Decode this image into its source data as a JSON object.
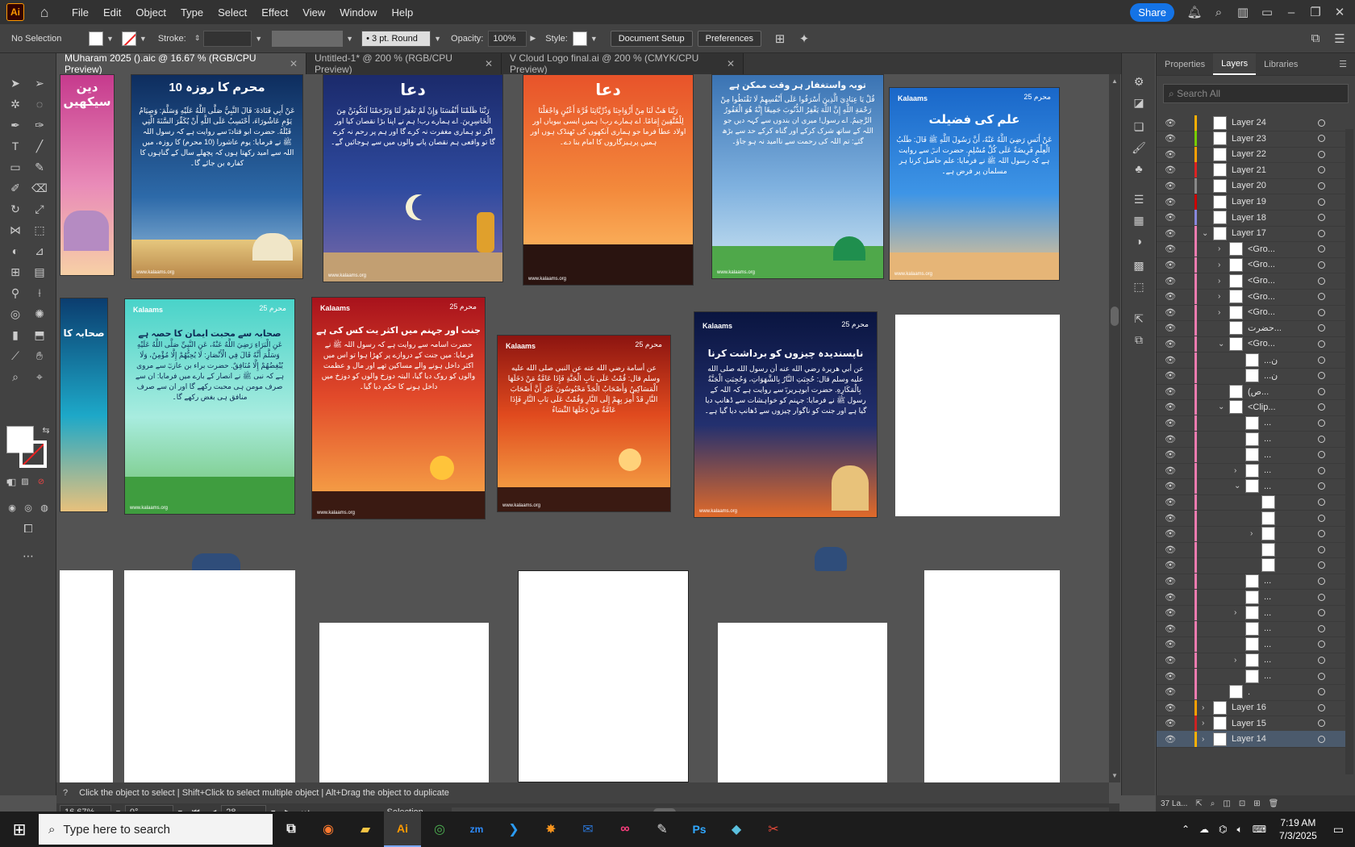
{
  "menubar": {
    "app_logo": "Ai",
    "menus": [
      "File",
      "Edit",
      "Object",
      "Type",
      "Select",
      "Effect",
      "View",
      "Window",
      "Help"
    ],
    "share_label": "Share"
  },
  "control_bar": {
    "selection": "No Selection",
    "stroke_label": "Stroke:",
    "brush": "3 pt. Round",
    "opacity_label": "Opacity:",
    "opacity_value": "100%",
    "style_label": "Style:",
    "document_setup": "Document Setup",
    "preferences": "Preferences"
  },
  "tabs": [
    {
      "label": "MUharam 2025 ().aic @ 16.67 % (RGB/CPU Preview)"
    },
    {
      "label": "Untitled-1* @ 200 % (RGB/CPU Preview)"
    },
    {
      "label": "V Cloud Logo final.ai @ 200 % (CMYK/CPU Preview)"
    }
  ],
  "artboards": {
    "a1_title": "دین سیکھیں",
    "a2_title": "10 محرم کا روزہ",
    "a2_body": "عَنْ أَبِي قَتَادَةَ: قَالَ النَّبِيُّ صَلَّى اللَّهُ عَلَيْهِ وَسَلَّمَ: وَصِيَامُ يَوْمِ عَاشُورَاءَ، أَحْتَسِبُ عَلَى اللَّهِ أَنْ يُكَفِّرَ السَّنَةَ الَّتِي قَبْلَهُ. حضرت ابو قتادہؓ سے روایت ہے کہ رسول اللہ ﷺ نے فرمایا: یوم عاشورا (10 محرم) کا روزہ، میں اللہ سے امید رکھتا ہوں کہ پچھلے سال کے گناہوں کا کفارہ بن جائے گا۔",
    "a3_title": "دعا",
    "a3_body": "رَبَّنَا ظَلَمْنَا أَنْفُسَنَا وَإِنْ لَمْ تَغْفِرْ لَنَا وَتَرْحَمْنَا لَنَكُونَنَّ مِنَ الْخَاسِرِينَ. اے ہمارے رب! ہم نے اپنا بڑا نقصان کیا اور اگر تو ہماری مغفرت نہ کرے گا اور ہم پر رحم نہ کرے گا تو واقعی ہم نقصان پانے والوں میں سے ہوجائیں گے۔",
    "a4_title": "دعا",
    "a4_body": "رَبَّنَا هَبْ لَنَا مِنْ أَزْوَاجِنَا وَذُرِّيَّاتِنَا قُرَّةَ أَعْيُنٍ وَاجْعَلْنَا لِلْمُتَّقِينَ إِمَامًا. اے ہمارے رب! ہمیں ایسی بیویاں اور اولاد عطا فرما جو ہماری آنکھوں کی ٹھنڈک ہوں اور ہمیں پرہیزگاروں کا امام بنا دے۔",
    "a5_title": "توبہ واستغفار ہر وقت ممکن ہے",
    "a5_body": "قُلْ يَا عِبَادِيَ الَّذِينَ أَسْرَفُوا عَلَى أَنْفُسِهِمْ لَا تَقْنَطُوا مِنْ رَحْمَةِ اللَّهِ إِنَّ اللَّهَ يَغْفِرُ الذُّنُوبَ جَمِيعًا إِنَّهُ هُوَ الْغَفُورُ الرَّحِيمُ. اے رسول! میری ان بندوں سے کہہ دیں جو اللہ کے ساتھ شرک کرکے اور گناہ کرکے حد سے بڑھ گئے: تم اللہ کی رحمت سے ناامید نہ ہو جاؤ۔",
    "a6_title": "علم کی فضیلت",
    "a6_body": "عَنْ أَنَسِ رَضِيَ اللَّهُ عَنْهُ، أَنَّ رَسُولَ اللَّهِ ﷺ قَالَ: طَلَبُ الْعِلْمِ فَرِيضَةٌ عَلَى كُلِّ مُسْلِمٍ. حضرت انسؓ سے روایت ہے کہ رسول اللہ ﷺ نے فرمایا: علم حاصل کرنا ہر مسلمان پر فرض ہے۔",
    "b1_title": "صحابہ کا",
    "b2_title": "صحابہ سے محبت ایمان کا حصہ ہے",
    "b2_body": "عَنِ الْبَرَاءِ رَضِيَ اللَّهُ عَنْهُ، عَنِ النَّبِيِّ صَلَّى اللَّهُ عَلَيْهِ وَسَلَّمَ أَنَّهُ قَالَ فِي الْأَنْصَارِ: لَا يُحِبُّهُمْ إِلَّا مُؤْمِنٌ، وَلَا يُبْغِضُهُمْ إِلَّا مُنَافِقٌ. حضرت براء بن عازبؓ سے مروی ہے کہ نبی ﷺ نے انصار کے بارے میں فرمایا: ان سے صرف مومن ہی محبت رکھے گا اور ان سے صرف منافق ہی بغض رکھے گا۔",
    "b3_title": "جنت اور جہنم میں اکثر یت کس کی ہے",
    "b3_body": "حضرت اسامہ سے روایت ہے کہ رسول اللہ ﷺ نے فرمایا: میں جنت کے دروازے پر کھڑا ہوا تو اس میں اکثر داخل ہونے والے مساکین تھے اور مال و عظمت والوں کو روک دیا گیا، البتہ دوزخ والوں کو دوزخ میں داخل ہونے کا حکم دیا گیا۔",
    "b4_body": "عن أسامة رضي الله عنه عن النبي صلى الله عليه وسلم قال: قُمْتُ عَلَى بَابِ الْجَنَّةِ فَإِذَا عَامَّةُ مَنْ دَخَلَهَا الْمَسَاكِينُ وَأَصْحَابُ الْجَدِّ مَحْبُوسُونَ غَيْرَ أَنَّ أَصْحَابَ النَّارِ قَدْ أُمِرَ بِهِمْ إِلَى النَّارِ وَقُمْتُ عَلَى بَابِ النَّارِ فَإِذَا عَامَّةُ مَنْ دَخَلَهَا النِّسَاءُ",
    "b5_title": "ناپسندیدہ چیزوں کو برداشت کرنا",
    "b5_body": "عن أبي هريرة رضي الله عنه أن رسول الله صلى الله عليه وسلم قال: حُجِبَتِ النَّارُ بِالشَّهَوَاتِ، وَحُجِبَتِ الْجَنَّةُ بِالْمَكَارِهِ. حضرت ابوہریرہؓ سے روایت ہے کہ اللہ کے رسول ﷺ نے فرمایا: جہنم کو خواہشات سے ڈھانپ دیا گیا ہے اور جنت کو ناگوار چیزوں سے ڈھانپ دیا گیا ہے۔",
    "brand": "Kalaams",
    "site": "www.kalaams.org",
    "badge": "محرم 25"
  },
  "status": {
    "hint": "Click the object to select  |  Shift+Click to select multiple object  |  Alt+Drag the object to duplicate",
    "zoom": "16.67%",
    "rotation": "0°",
    "artboard_no": "28",
    "mode": "Selection"
  },
  "panel": {
    "tabs": [
      "Properties",
      "Layers",
      "Libraries"
    ],
    "search_placeholder": "Search All",
    "layers": [
      {
        "name": "Layer 24",
        "color": "#ffb000"
      },
      {
        "name": "Layer 23",
        "color": "#77cc00"
      },
      {
        "name": "Layer 22",
        "color": "#ffa000"
      },
      {
        "name": "Layer 21",
        "color": "#dd2222"
      },
      {
        "name": "Layer 20",
        "color": "#888888"
      },
      {
        "name": "Layer 19",
        "color": "#cc0000"
      },
      {
        "name": "Layer 18",
        "color": "#8888dd"
      },
      {
        "name": "Layer 17",
        "color": "#ee7bb0"
      },
      {
        "name": "<Gro...",
        "color": "#ee7bb0"
      },
      {
        "name": "<Gro...",
        "color": "#ee7bb0"
      },
      {
        "name": "<Gro...",
        "color": "#ee7bb0"
      },
      {
        "name": "<Gro...",
        "color": "#ee7bb0"
      },
      {
        "name": "<Gro...",
        "color": "#ee7bb0"
      },
      {
        "name": "حضرت...",
        "color": "#ee7bb0"
      },
      {
        "name": "<Gro...",
        "color": "#ee7bb0"
      },
      {
        "name": "...ن",
        "color": "#ee7bb0"
      },
      {
        "name": "...ن",
        "color": "#ee7bb0"
      },
      {
        "name": "(ص...",
        "color": "#ee7bb0"
      },
      {
        "name": "<Clip...",
        "color": "#ee7bb0"
      },
      {
        "name": "...",
        "color": "#ee7bb0"
      },
      {
        "name": "...",
        "color": "#ee7bb0"
      },
      {
        "name": "...",
        "color": "#ee7bb0"
      },
      {
        "name": "...",
        "color": "#ee7bb0"
      },
      {
        "name": "...",
        "color": "#ee7bb0"
      },
      {
        "name": "",
        "color": "#ee7bb0"
      },
      {
        "name": "",
        "color": "#ee7bb0"
      },
      {
        "name": "",
        "color": "#ee7bb0"
      },
      {
        "name": "",
        "color": "#ee7bb0"
      },
      {
        "name": "",
        "color": "#ee7bb0"
      },
      {
        "name": "...",
        "color": "#ee7bb0"
      },
      {
        "name": "...",
        "color": "#ee7bb0"
      },
      {
        "name": "...",
        "color": "#ee7bb0"
      },
      {
        "name": "...",
        "color": "#ee7bb0"
      },
      {
        "name": "...",
        "color": "#ee7bb0"
      },
      {
        "name": "...",
        "color": "#ee7bb0"
      },
      {
        "name": "...",
        "color": "#ee7bb0"
      },
      {
        "name": ".",
        "color": "#ee7bb0"
      },
      {
        "name": "Layer 16",
        "color": "#ffa000"
      },
      {
        "name": "Layer 15",
        "color": "#cc2222"
      },
      {
        "name": "Layer 14",
        "color": "#ffb000"
      }
    ],
    "footer": "37 La..."
  },
  "taskbar": {
    "search_placeholder": "Type here to search",
    "time": "7:19 AM",
    "date": "7/3/2025"
  }
}
